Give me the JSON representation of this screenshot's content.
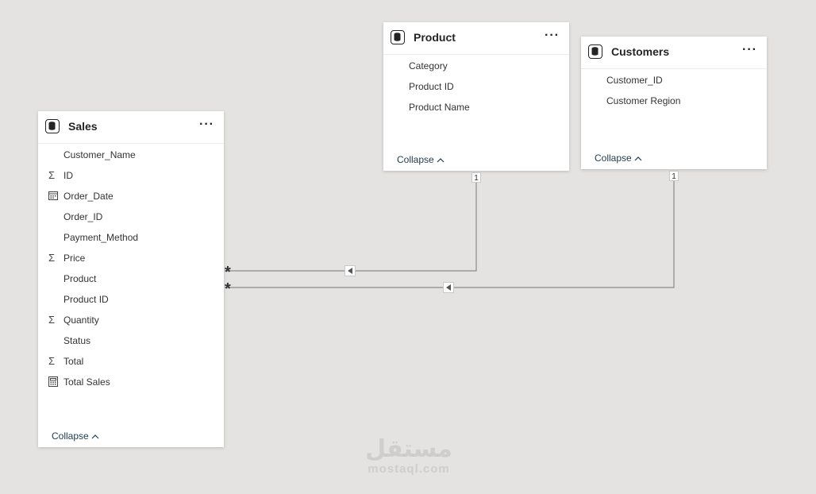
{
  "tables": {
    "sales": {
      "title": "Sales",
      "more": "···",
      "collapse": "Collapse",
      "fields": [
        {
          "label": "Customer_Name",
          "icon": "none"
        },
        {
          "label": "ID",
          "icon": "sigma"
        },
        {
          "label": "Order_Date",
          "icon": "calendar"
        },
        {
          "label": "Order_ID",
          "icon": "none"
        },
        {
          "label": "Payment_Method",
          "icon": "none"
        },
        {
          "label": "Price",
          "icon": "sigma"
        },
        {
          "label": "Product",
          "icon": "none"
        },
        {
          "label": "Product ID",
          "icon": "none"
        },
        {
          "label": "Quantity",
          "icon": "sigma"
        },
        {
          "label": "Status",
          "icon": "none"
        },
        {
          "label": "Total",
          "icon": "sigma"
        },
        {
          "label": "Total Sales",
          "icon": "calculator"
        }
      ]
    },
    "product": {
      "title": "Product",
      "more": "···",
      "collapse": "Collapse",
      "fields": [
        {
          "label": "Category",
          "icon": "none"
        },
        {
          "label": "Product ID",
          "icon": "none"
        },
        {
          "label": "Product Name",
          "icon": "none"
        }
      ]
    },
    "customers": {
      "title": "Customers",
      "more": "···",
      "collapse": "Collapse",
      "fields": [
        {
          "label": "Customer_ID",
          "icon": "none"
        },
        {
          "label": "Customer Region",
          "icon": "none"
        }
      ]
    }
  },
  "relationships": {
    "one_label": "1",
    "many_label": "*"
  },
  "watermark": {
    "arabic": "مستقل",
    "latin": "mostaql.com"
  },
  "icons": {
    "sigma": "Σ",
    "collapse_chevron": "^"
  }
}
